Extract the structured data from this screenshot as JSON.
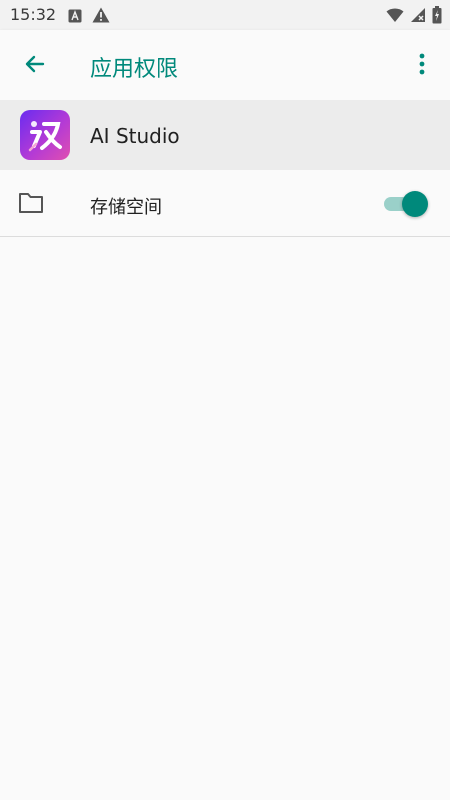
{
  "status_bar": {
    "time": "15:32",
    "icons": [
      "a-box-icon",
      "warning-icon",
      "wifi-icon",
      "signal-off-icon",
      "battery-icon"
    ]
  },
  "app_bar": {
    "title": "应用权限",
    "back_icon": "arrow-back-icon",
    "menu_icon": "more-vert-icon",
    "accent_color": "#00897b"
  },
  "app": {
    "name": "AI Studio",
    "icon": "ai-studio-app-icon"
  },
  "permissions": [
    {
      "label": "存储空间",
      "icon": "folder-icon",
      "enabled": true
    }
  ]
}
